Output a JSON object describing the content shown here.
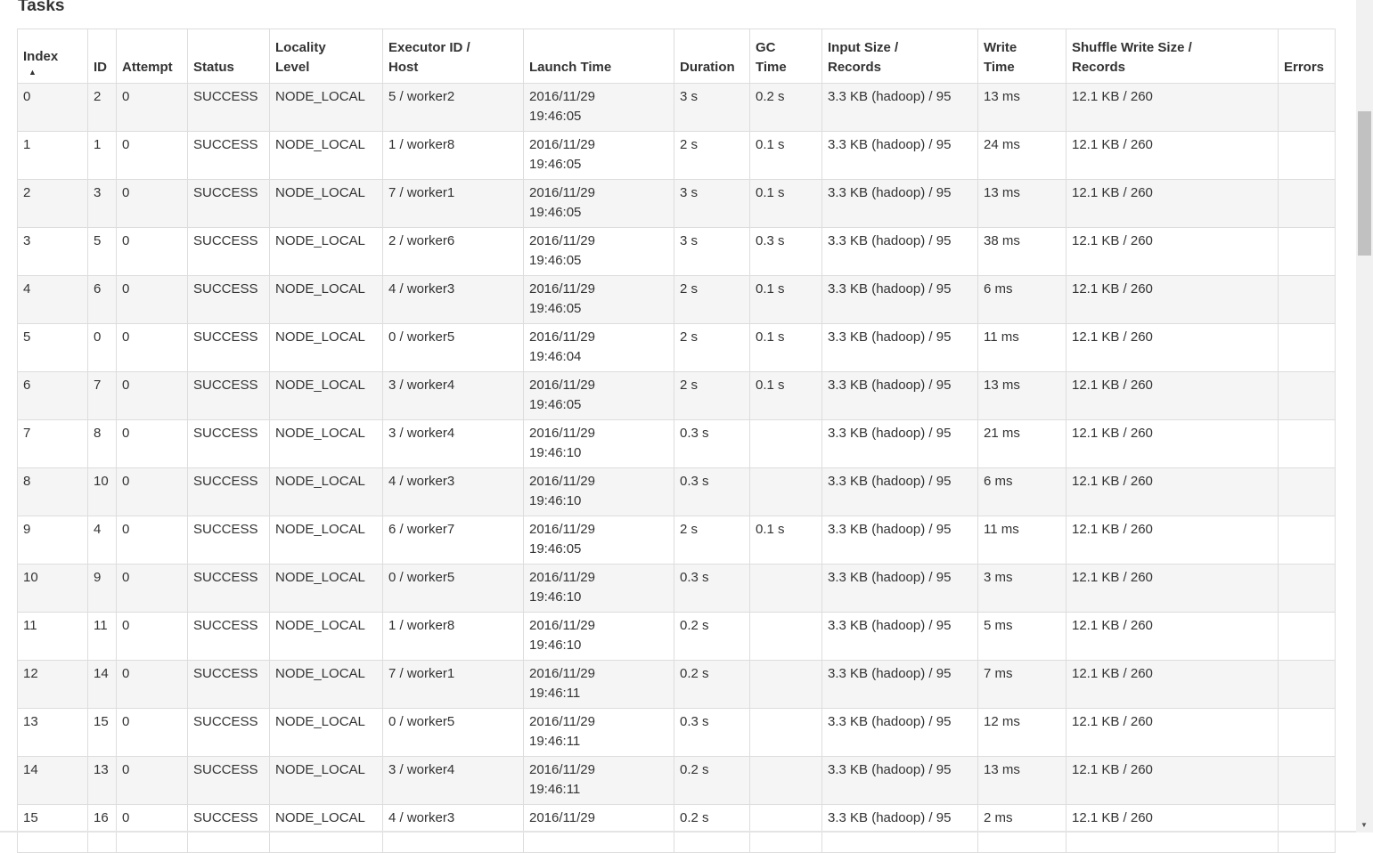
{
  "title": "Tasks",
  "sort_arrow": "▲",
  "columns": [
    {
      "l1": "Index",
      "l2": ""
    },
    {
      "l1": "",
      "l2": "ID"
    },
    {
      "l1": "",
      "l2": "Attempt"
    },
    {
      "l1": "",
      "l2": "Status"
    },
    {
      "l1": "Locality",
      "l2": "Level"
    },
    {
      "l1": "Executor ID /",
      "l2": "Host"
    },
    {
      "l1": "",
      "l2": "Launch Time"
    },
    {
      "l1": "",
      "l2": "Duration"
    },
    {
      "l1": "GC",
      "l2": "Time"
    },
    {
      "l1": "Input Size /",
      "l2": "Records"
    },
    {
      "l1": "Write",
      "l2": "Time"
    },
    {
      "l1": "Shuffle Write Size /",
      "l2": "Records"
    },
    {
      "l1": "",
      "l2": "Errors"
    }
  ],
  "rows": [
    [
      "0",
      "2",
      "0",
      "SUCCESS",
      "NODE_LOCAL",
      "5 / worker2",
      "2016/11/29",
      "19:46:05",
      "3 s",
      "0.2 s",
      "3.3 KB (hadoop) / 95",
      "13 ms",
      "12.1 KB / 260",
      ""
    ],
    [
      "1",
      "1",
      "0",
      "SUCCESS",
      "NODE_LOCAL",
      "1 / worker8",
      "2016/11/29",
      "19:46:05",
      "2 s",
      "0.1 s",
      "3.3 KB (hadoop) / 95",
      "24 ms",
      "12.1 KB / 260",
      ""
    ],
    [
      "2",
      "3",
      "0",
      "SUCCESS",
      "NODE_LOCAL",
      "7 / worker1",
      "2016/11/29",
      "19:46:05",
      "3 s",
      "0.1 s",
      "3.3 KB (hadoop) / 95",
      "13 ms",
      "12.1 KB / 260",
      ""
    ],
    [
      "3",
      "5",
      "0",
      "SUCCESS",
      "NODE_LOCAL",
      "2 / worker6",
      "2016/11/29",
      "19:46:05",
      "3 s",
      "0.3 s",
      "3.3 KB (hadoop) / 95",
      "38 ms",
      "12.1 KB / 260",
      ""
    ],
    [
      "4",
      "6",
      "0",
      "SUCCESS",
      "NODE_LOCAL",
      "4 / worker3",
      "2016/11/29",
      "19:46:05",
      "2 s",
      "0.1 s",
      "3.3 KB (hadoop) / 95",
      "6 ms",
      "12.1 KB / 260",
      ""
    ],
    [
      "5",
      "0",
      "0",
      "SUCCESS",
      "NODE_LOCAL",
      "0 / worker5",
      "2016/11/29",
      "19:46:04",
      "2 s",
      "0.1 s",
      "3.3 KB (hadoop) / 95",
      "11 ms",
      "12.1 KB / 260",
      ""
    ],
    [
      "6",
      "7",
      "0",
      "SUCCESS",
      "NODE_LOCAL",
      "3 / worker4",
      "2016/11/29",
      "19:46:05",
      "2 s",
      "0.1 s",
      "3.3 KB (hadoop) / 95",
      "13 ms",
      "12.1 KB / 260",
      ""
    ],
    [
      "7",
      "8",
      "0",
      "SUCCESS",
      "NODE_LOCAL",
      "3 / worker4",
      "2016/11/29",
      "19:46:10",
      "0.3 s",
      "",
      "3.3 KB (hadoop) / 95",
      "21 ms",
      "12.1 KB / 260",
      ""
    ],
    [
      "8",
      "10",
      "0",
      "SUCCESS",
      "NODE_LOCAL",
      "4 / worker3",
      "2016/11/29",
      "19:46:10",
      "0.3 s",
      "",
      "3.3 KB (hadoop) / 95",
      "6 ms",
      "12.1 KB / 260",
      ""
    ],
    [
      "9",
      "4",
      "0",
      "SUCCESS",
      "NODE_LOCAL",
      "6 / worker7",
      "2016/11/29",
      "19:46:05",
      "2 s",
      "0.1 s",
      "3.3 KB (hadoop) / 95",
      "11 ms",
      "12.1 KB / 260",
      ""
    ],
    [
      "10",
      "9",
      "0",
      "SUCCESS",
      "NODE_LOCAL",
      "0 / worker5",
      "2016/11/29",
      "19:46:10",
      "0.3 s",
      "",
      "3.3 KB (hadoop) / 95",
      "3 ms",
      "12.1 KB / 260",
      ""
    ],
    [
      "11",
      "11",
      "0",
      "SUCCESS",
      "NODE_LOCAL",
      "1 / worker8",
      "2016/11/29",
      "19:46:10",
      "0.2 s",
      "",
      "3.3 KB (hadoop) / 95",
      "5 ms",
      "12.1 KB / 260",
      ""
    ],
    [
      "12",
      "14",
      "0",
      "SUCCESS",
      "NODE_LOCAL",
      "7 / worker1",
      "2016/11/29",
      "19:46:11",
      "0.2 s",
      "",
      "3.3 KB (hadoop) / 95",
      "7 ms",
      "12.1 KB / 260",
      ""
    ],
    [
      "13",
      "15",
      "0",
      "SUCCESS",
      "NODE_LOCAL",
      "0 / worker5",
      "2016/11/29",
      "19:46:11",
      "0.3 s",
      "",
      "3.3 KB (hadoop) / 95",
      "12 ms",
      "12.1 KB / 260",
      ""
    ],
    [
      "14",
      "13",
      "0",
      "SUCCESS",
      "NODE_LOCAL",
      "3 / worker4",
      "2016/11/29",
      "19:46:11",
      "0.2 s",
      "",
      "3.3 KB (hadoop) / 95",
      "13 ms",
      "12.1 KB / 260",
      ""
    ],
    [
      "15",
      "16",
      "0",
      "SUCCESS",
      "NODE_LOCAL",
      "4 / worker3",
      "2016/11/29",
      "",
      "0.2 s",
      "",
      "3.3 KB (hadoop) / 95",
      "2 ms",
      "12.1 KB / 260",
      ""
    ]
  ]
}
